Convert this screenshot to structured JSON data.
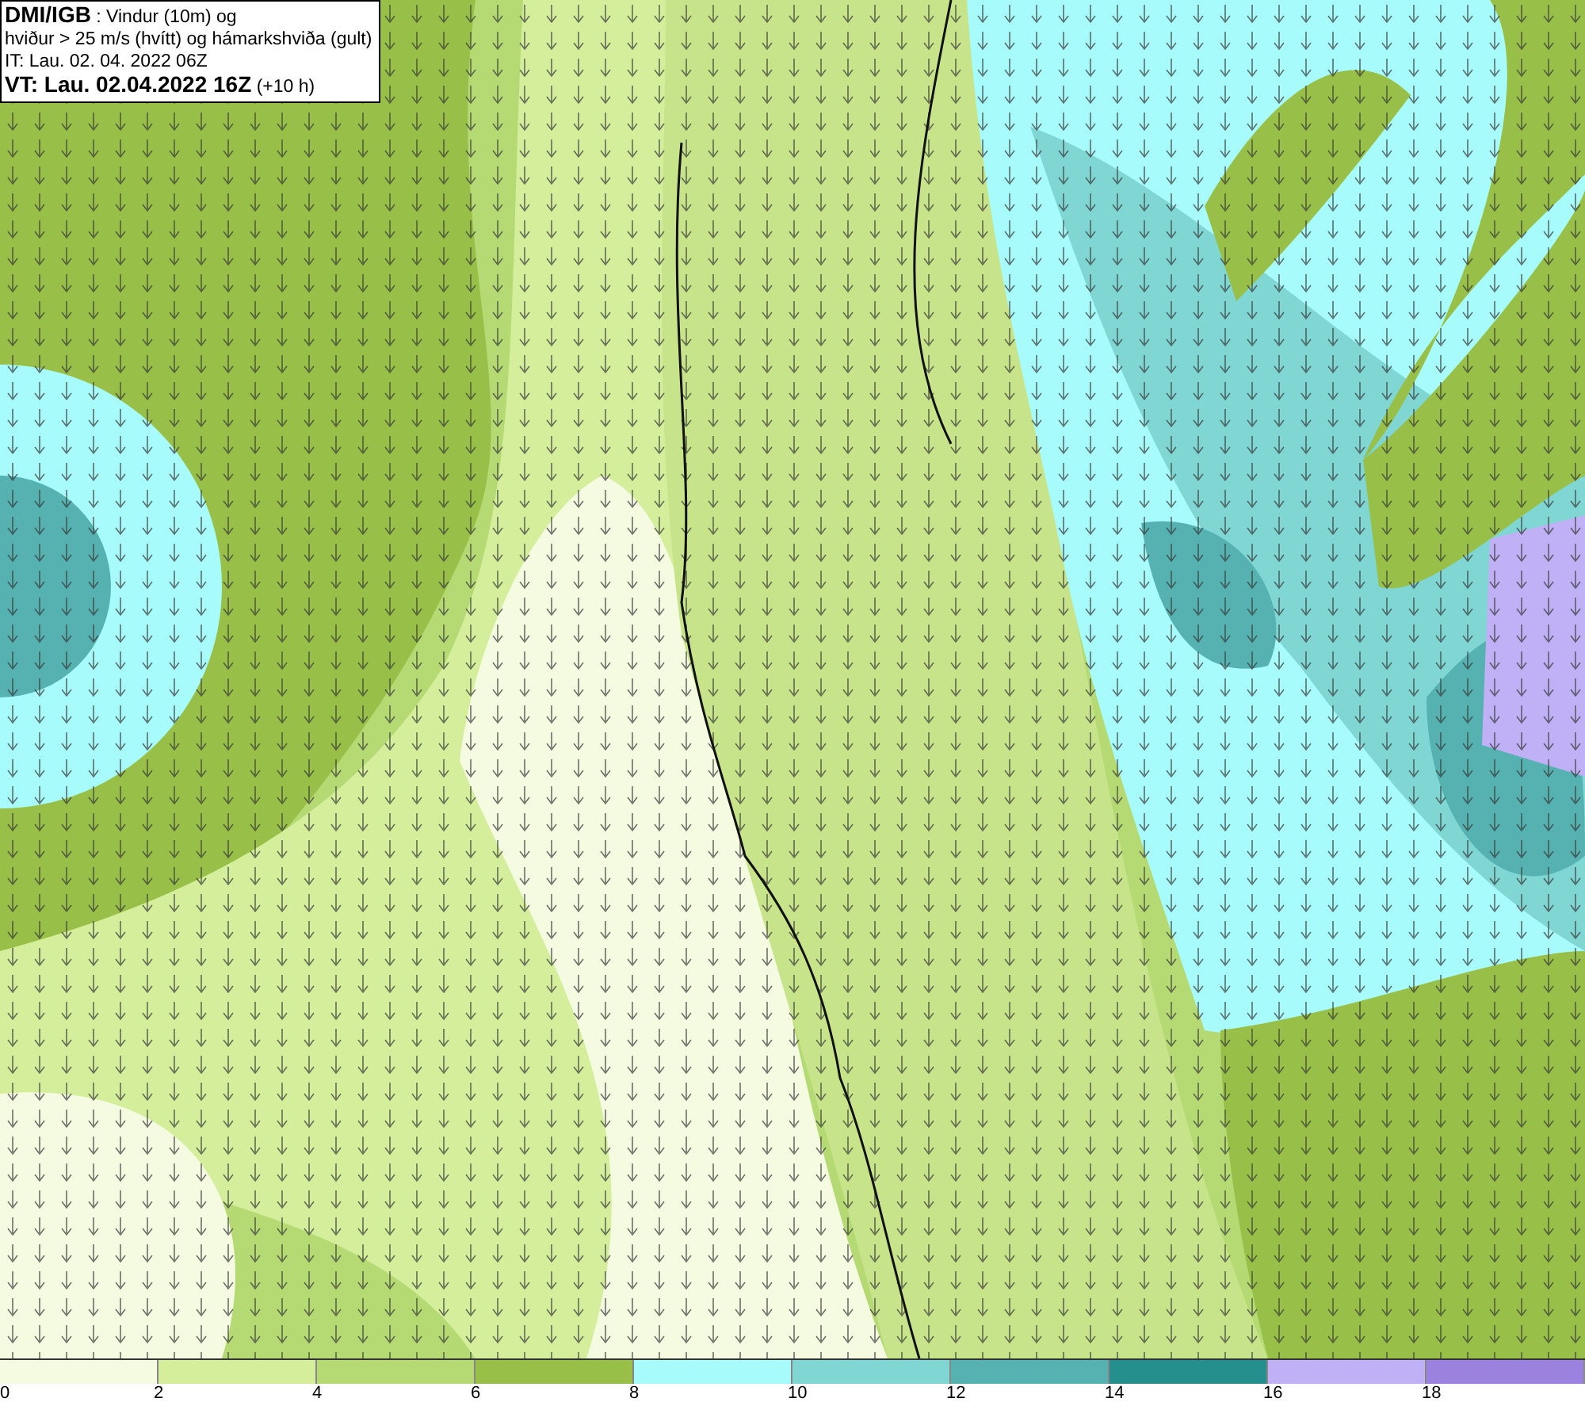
{
  "title_box": {
    "lines": [
      "**DMI/IGB** : Vindur (10m) og",
      "hviður > 25 m/s (hvítt) og hámarkshviða (gult)",
      "IT: Lau. 02. 04. 2022 06Z",
      "**VT: Lau. 02.04.2022 16Z** (+10 h)"
    ]
  },
  "legend": {
    "bins": [
      {
        "color": "#f4fbe0",
        "label": "0"
      },
      {
        "color": "#d4ee9c",
        "label": "2"
      },
      {
        "color": "#b5da74",
        "label": "4"
      },
      {
        "color": "#98c048",
        "label": "6"
      },
      {
        "color": "#a8fbfb",
        "label": "8"
      },
      {
        "color": "#7fd6d3",
        "label": "10"
      },
      {
        "color": "#55b2b0",
        "label": "12"
      },
      {
        "color": "#248f8c",
        "label": "14"
      },
      {
        "color": "#c0b0f5",
        "label": "16"
      },
      {
        "color": "#9a82de",
        "label": "18"
      }
    ]
  }
}
